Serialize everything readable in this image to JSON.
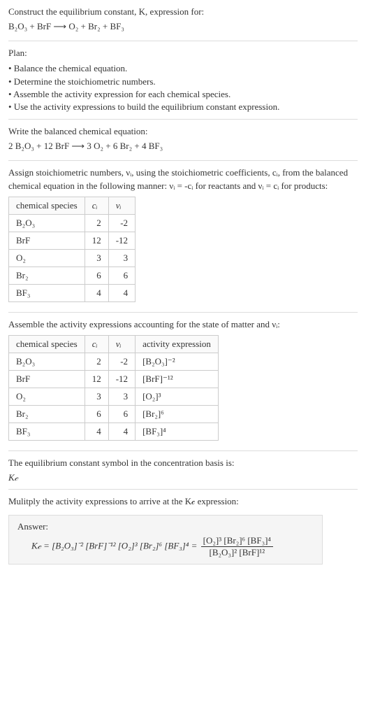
{
  "intro": {
    "line1": "Construct the equilibrium constant, K, expression for:",
    "equation": "B₂O₃ + BrF ⟶ O₂ + Br₂ + BF₃"
  },
  "plan": {
    "title": "Plan:",
    "items": [
      "• Balance the chemical equation.",
      "• Determine the stoichiometric numbers.",
      "• Assemble the activity expression for each chemical species.",
      "• Use the activity expressions to build the equilibrium constant expression."
    ]
  },
  "balanced": {
    "line1": "Write the balanced chemical equation:",
    "equation": "2 B₂O₃ + 12 BrF ⟶ 3 O₂ + 6 Br₂ + 4 BF₃"
  },
  "stoich": {
    "text": "Assign stoichiometric numbers, νᵢ, using the stoichiometric coefficients, cᵢ, from the balanced chemical equation in the following manner: νᵢ = -cᵢ for reactants and νᵢ = cᵢ for products:",
    "headers": [
      "chemical species",
      "cᵢ",
      "νᵢ"
    ],
    "rows": [
      {
        "species": "B₂O₃",
        "c": "2",
        "v": "-2"
      },
      {
        "species": "BrF",
        "c": "12",
        "v": "-12"
      },
      {
        "species": "O₂",
        "c": "3",
        "v": "3"
      },
      {
        "species": "Br₂",
        "c": "6",
        "v": "6"
      },
      {
        "species": "BF₃",
        "c": "4",
        "v": "4"
      }
    ]
  },
  "activity": {
    "text": "Assemble the activity expressions accounting for the state of matter and νᵢ:",
    "headers": [
      "chemical species",
      "cᵢ",
      "νᵢ",
      "activity expression"
    ],
    "rows": [
      {
        "species": "B₂O₃",
        "c": "2",
        "v": "-2",
        "act": "[B₂O₃]⁻²"
      },
      {
        "species": "BrF",
        "c": "12",
        "v": "-12",
        "act": "[BrF]⁻¹²"
      },
      {
        "species": "O₂",
        "c": "3",
        "v": "3",
        "act": "[O₂]³"
      },
      {
        "species": "Br₂",
        "c": "6",
        "v": "6",
        "act": "[Br₂]⁶"
      },
      {
        "species": "BF₃",
        "c": "4",
        "v": "4",
        "act": "[BF₃]⁴"
      }
    ]
  },
  "symbol": {
    "line1": "The equilibrium constant symbol in the concentration basis is:",
    "line2": "K𝒸"
  },
  "multiply": {
    "text": "Mulitply the activity expressions to arrive at the K𝒸 expression:"
  },
  "answer": {
    "label": "Answer:",
    "lhs": "K𝒸 = [B₂O₃]⁻² [BrF]⁻¹² [O₂]³ [Br₂]⁶ [BF₃]⁴ = ",
    "frac_top": "[O₂]³ [Br₂]⁶ [BF₃]⁴",
    "frac_bot": "[B₂O₃]² [BrF]¹²"
  }
}
